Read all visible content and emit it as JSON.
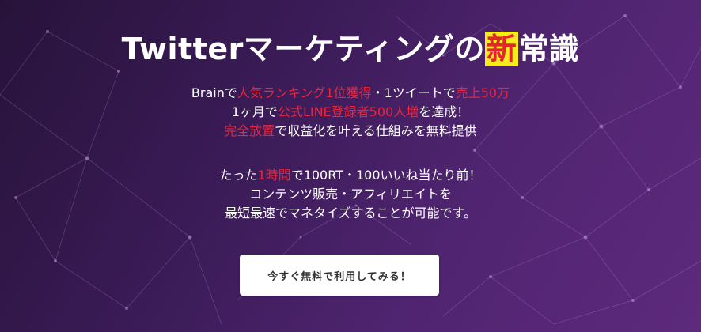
{
  "hero": {
    "title": {
      "before": "Twitterマーケティングの",
      "highlight": "新",
      "after": "常識"
    },
    "block1": {
      "line1": {
        "p1": "Brainで",
        "p2": "人気ランキング1位獲得",
        "p3": "・1ツイートで",
        "p4": "売上50万"
      },
      "line2": {
        "p1": "1ヶ月で",
        "p2": "公式LINE登録者500人増",
        "p3": "を達成！"
      },
      "line3": {
        "p1": "完全放置",
        "p2": "で収益化を叶える仕組みを無料提供"
      }
    },
    "block2": {
      "line1": {
        "p1": "たった",
        "p2": "1時間",
        "p3": "で100RT・100いいね当たり前！"
      },
      "line2": "コンテンツ販売・アフィリエイトを",
      "line3": "最短最速でマネタイズすることが可能です。"
    },
    "cta_label": "今すぐ無料で利用してみる！"
  },
  "colors": {
    "accent_red": "#e8263f",
    "highlight_yellow": "#f7ea1f",
    "bg_purple": "#4f2470"
  }
}
